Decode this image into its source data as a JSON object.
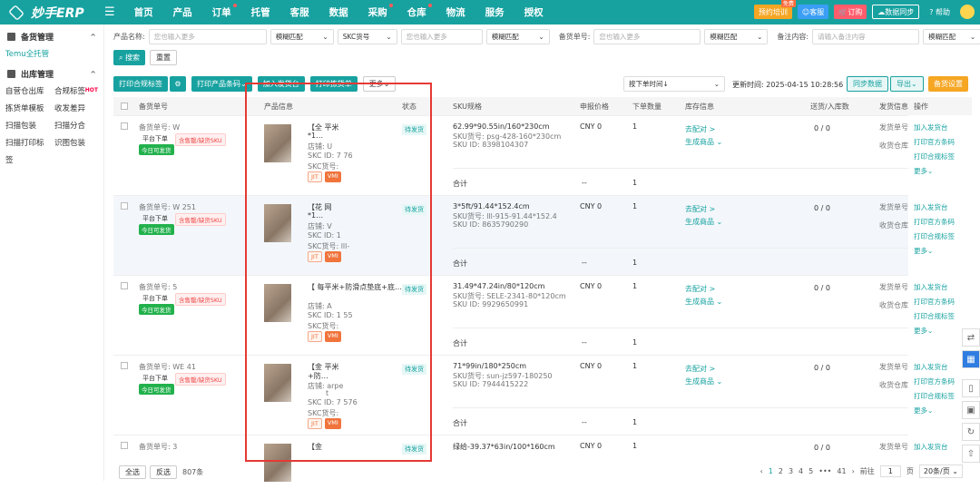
{
  "app": {
    "name": "妙手ERP"
  },
  "nav": [
    {
      "label": "首页",
      "dot": false
    },
    {
      "label": "产品",
      "dot": false
    },
    {
      "label": "订单",
      "dot": true
    },
    {
      "label": "托管",
      "dot": false
    },
    {
      "label": "客服",
      "dot": false
    },
    {
      "label": "数据",
      "dot": false
    },
    {
      "label": "采购",
      "dot": true
    },
    {
      "label": "仓库",
      "dot": true
    },
    {
      "label": "物流",
      "dot": false
    },
    {
      "label": "服务",
      "dot": false
    },
    {
      "label": "授权",
      "dot": false
    }
  ],
  "top_right": {
    "training": "预约培训",
    "training_badge": "免费",
    "service": "客服",
    "order": "订购",
    "sync": "数据同步",
    "help": "帮助"
  },
  "sidebar": {
    "group1": "备货管理",
    "group1_item": "Temu全托管",
    "group2": "出库管理",
    "rows": [
      [
        "自营仓出库",
        "合规标签"
      ],
      [
        "拣货单模板",
        "收发差异"
      ],
      [
        "扫描包装",
        "扫描分合"
      ],
      [
        "扫描打印标签",
        "识图包装"
      ]
    ],
    "hot": "HOT"
  },
  "filters": {
    "name_label": "产品名称:",
    "name_ph": "您也输入更多",
    "match": "模糊匹配",
    "skc_label": "SKC货号",
    "skc_ph": "您也输入更多",
    "match2": "模糊匹配",
    "stock_label": "备货单号:",
    "stock_ph": "您也输入更多",
    "match3": "模糊匹配",
    "note_label": "备注内容:",
    "note_ph": "请输入备注内容",
    "match4": "模糊匹配",
    "search": "搜索",
    "reset": "重置"
  },
  "toolbar": {
    "print_label": "打印合规标签",
    "print_barcode": "打印产品条码",
    "add_ship": "加入发货台",
    "print_pick": "打印拣货单",
    "more": "更多",
    "sort": "按下单时间↓",
    "update": "更新时间: 2025-04-15 10:28:56",
    "sync_data": "同步数据",
    "export": "导出",
    "stock_settings": "备货设置"
  },
  "columns": {
    "order": "备货单号",
    "product": "产品信息",
    "status": "状态",
    "sku": "SKU规格",
    "price": "申报价格",
    "qty": "下单数量",
    "stock": "库存信息",
    "delivered": "送货/入库数",
    "ship": "发货信息",
    "ops": "操作"
  },
  "rows": [
    {
      "order": "备货单号: W",
      "platform": "平台下单",
      "warn": "含售罄/缺货SKU",
      "today": "今日可发货",
      "title": "【全",
      ".": "",
      "title2": "平米",
      "title3": "*1…",
      "shop": "店铺: U",
      "skc_id": "SKC ID: 7",
      "skc_id2": "76",
      "skc_no": "SKC货号:",
      "status": "待发货",
      "sku": "62.99*90.55in/160*230cm",
      "sku_no": "SKU货号: psg-428-160*230cm",
      "sku_id": "SKU ID: 8398104307",
      "price": "CNY 0",
      "qty": "1",
      "match": "去配对 >",
      "gen": "生成商品",
      "deliv": "0 / 0",
      "ship1": "发货单号",
      "ship2": "收货仓库",
      "total": "合计",
      "dash": "--",
      "tqty": "1"
    },
    {
      "order": "备货单号: W",
      "order_tail": "251",
      "platform": "平台下单",
      "warn": "含售罄/缺货SKU",
      "today": "今日可发货",
      "title": "【花",
      "title2": "网",
      "title3": "*1…",
      "shop": "店铺: V",
      "skc_id": "SKC ID: 1",
      "skc_no": "SKC货号: lll-",
      "status": "待发货",
      "sku": "3*5ft/91.44*152.4cm",
      "sku_no": "SKU货号: lll-915-91.44*152.4",
      "sku_id": "SKU ID: 8635790290",
      "price": "CNY 0",
      "qty": "1",
      "match": "去配对 >",
      "gen": "生成商品",
      "deliv": "0 / 0",
      "ship1": "发货单号",
      "ship2": "收货仓库",
      "total": "合计",
      "dash": "--",
      "tqty": "1"
    },
    {
      "order": "备货单号:",
      "order_tail": "5",
      "platform": "平台下单",
      "warn": "含售罄/缺货SKU",
      "today": "今日可发货",
      "title": "【",
      "title2": "每平米+防滑点垫底+底…",
      "shop": "店铺: A",
      "skc_id": "SKC ID: 1",
      "skc_id2": "55",
      "skc_no": "SKC货号:",
      "status": "待发货",
      "sku": "31.49*47.24in/80*120cm",
      "sku_no": "SKU货号: SELE-2341-80*120cm",
      "sku_id": "SKU ID: 9929650991",
      "price": "CNY 0",
      "qty": "1",
      "match": "去配对 >",
      "gen": "生成商品",
      "deliv": "0 / 0",
      "ship1": "发货单号",
      "ship2": "收货仓库",
      "total": "合计",
      "dash": "--",
      "tqty": "1"
    },
    {
      "order": "备货单号: WE",
      "order_tail": "41",
      "platform": "平台下单",
      "warn": "含售罄/缺货SKU",
      "today": "今日可发货",
      "title": "【金",
      "title2": "平米",
      "title3": "+防…",
      "shop": "店铺:",
      "shop2": "arpe",
      "shop3": "t",
      "skc_id": "SKC ID: 7",
      "skc_id2": "576",
      "skc_no": "SKC货号:",
      "status": "待发货",
      "sku": "71*99in/180*250cm",
      "sku_no": "SKU货号: sun-jz597-180250",
      "sku_id": "SKU ID: 7944415222",
      "price": "CNY 0",
      "qty": "1",
      "match": "去配对 >",
      "gen": "生成商品",
      "deliv": "0 / 0",
      "ship1": "发货单号",
      "ship2": "收货仓库",
      "total": "合计",
      "dash": "--",
      "tqty": "1"
    },
    {
      "order": "备货单号:",
      "order_tail": "3",
      "status": "待发货",
      "sku": "绿给-39.37*63in/100*160cm",
      "price": "CNY 0",
      "qty": "1",
      "deliv": "0 / 0",
      "ship1": "发货单号",
      "title": "【金"
    }
  ],
  "tags": {
    "jit": "JIT",
    "vmi": "VMI"
  },
  "ops": [
    "加入发货台",
    "打印官方条码",
    "打印合规标签",
    "更多"
  ],
  "footer": {
    "select_all": "全选",
    "invert": "反选",
    "count": "807条",
    "pages": [
      "1",
      "2",
      "3",
      "4",
      "5",
      "•••",
      "41"
    ],
    "goto": "前往",
    "page_no": "1",
    "page_unit": "页",
    "per_page": "20条/页"
  },
  "colors": {
    "primary": "#17a2a0",
    "red_box": "#e53935"
  }
}
